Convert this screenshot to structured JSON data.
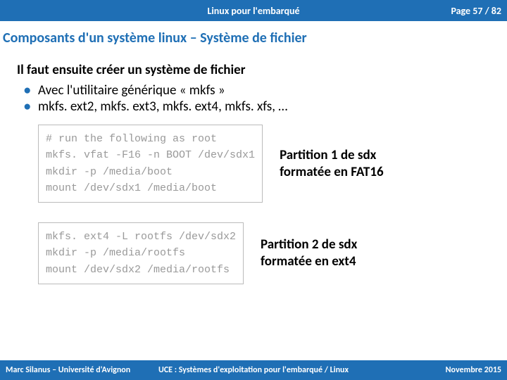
{
  "header": {
    "title": "Linux pour l'embarqué",
    "page": "Page 57 / 82"
  },
  "section_title": "Composants d'un système linux – Système de fichier",
  "intro": "Il faut ensuite créer un système de fichier",
  "bullets": [
    "Avec l'utilitaire générique « mkfs »",
    "mkfs. ext2, mkfs. ext3, mkfs. ext4, mkfs. xfs, …"
  ],
  "code1": {
    "lines": [
      "# run the following as root",
      "mkfs. vfat -F16 -n BOOT /dev/sdx1",
      "mkdir -p /media/boot",
      "mount /dev/sdx1 /media/boot"
    ],
    "caption_l1": "Partition 1 de sdx",
    "caption_l2": "formatée en FAT16"
  },
  "code2": {
    "lines": [
      "mkfs. ext4 -L rootfs /dev/sdx2",
      "mkdir -p /media/rootfs",
      "mount /dev/sdx2 /media/rootfs"
    ],
    "caption_l1": "Partition 2 de sdx",
    "caption_l2": "formatée en ext4"
  },
  "footer": {
    "left": "Marc Silanus – Université d'Avignon",
    "center": "UCE : Systèmes d'exploitation pour l'embarqué / Linux",
    "right": "Novembre 2015"
  }
}
